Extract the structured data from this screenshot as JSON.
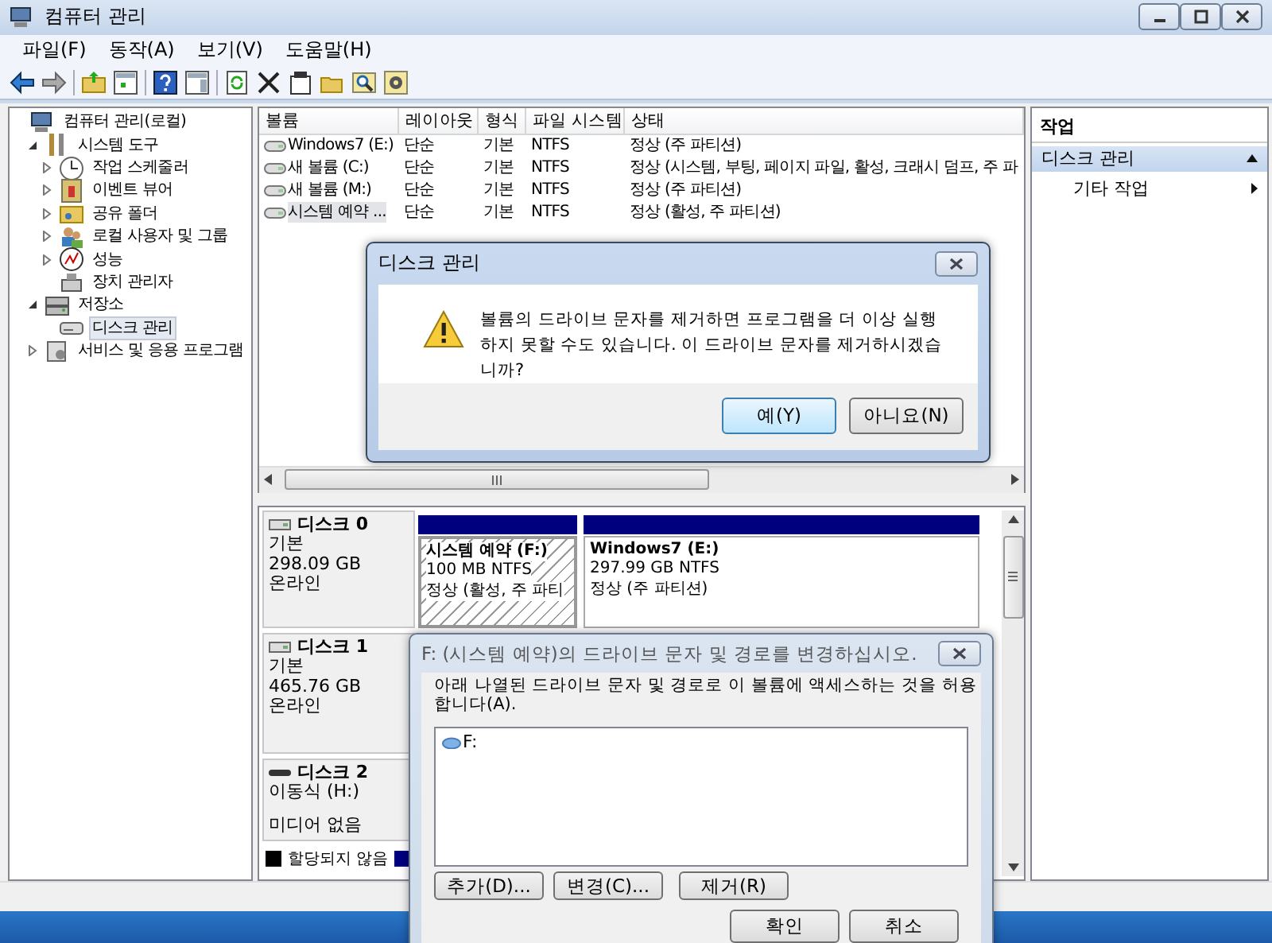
{
  "window": {
    "title": "컴퓨터 관리"
  },
  "menu": [
    "파일(F)",
    "동작(A)",
    "보기(V)",
    "도움말(H)"
  ],
  "tree": [
    {
      "label": "컴퓨터 관리(로컬)",
      "selected": false,
      "children": [
        {
          "label": "시스템 도구",
          "expanded": true,
          "selected": false,
          "children": [
            {
              "label": "작업 스케줄러",
              "expanded": false,
              "selected": false
            },
            {
              "label": "이벤트 뷰어",
              "expanded": false,
              "selected": false
            },
            {
              "label": "공유 폴더",
              "expanded": false,
              "selected": false
            },
            {
              "label": "로컬 사용자 및 그룹",
              "expanded": false,
              "selected": false
            },
            {
              "label": "성능",
              "expanded": false,
              "selected": false
            },
            {
              "label": "장치 관리자",
              "selected": false
            }
          ]
        },
        {
          "label": "저장소",
          "expanded": true,
          "selected": false,
          "children": [
            {
              "label": "디스크 관리",
              "selected": true
            }
          ]
        },
        {
          "label": "서비스 및 응용 프로그램",
          "expanded": false,
          "selected": false
        }
      ]
    }
  ],
  "volume_table": {
    "columns": [
      "볼륨",
      "레이아웃",
      "형식",
      "파일 시스템",
      "상태"
    ],
    "rows": [
      {
        "cells": [
          "Windows7 (E:)",
          "단순",
          "기본",
          "NTFS",
          "정상 (주 파티션)"
        ],
        "selected": false
      },
      {
        "cells": [
          "새 볼륨 (C:)",
          "단순",
          "기본",
          "NTFS",
          "정상 (시스템, 부팅, 페이지 파일, 활성, 크래시 덤프, 주 파"
        ],
        "selected": false
      },
      {
        "cells": [
          "새 볼륨 (M:)",
          "단순",
          "기본",
          "NTFS",
          "정상 (주 파티션)"
        ],
        "selected": false
      },
      {
        "cells": [
          "시스템 예약 ...",
          "단순",
          "기본",
          "NTFS",
          "정상 (활성, 주 파티션)"
        ],
        "selected": true
      }
    ]
  },
  "disks": [
    {
      "kind": "fixed",
      "name": "디스크 0",
      "type": "기본",
      "size": "298.09 GB",
      "status": "온라인",
      "partitions": [
        {
          "name": "시스템 예약  (F:)",
          "size": "100 MB NTFS",
          "status": "정상 (활성, 주 파티",
          "selected": true
        },
        {
          "name": "Windows7  (E:)",
          "size": "297.99 GB NTFS",
          "status": "정상 (주 파티션)",
          "selected": false
        }
      ]
    },
    {
      "kind": "fixed",
      "name": "디스크 1",
      "type": "기본",
      "size": "465.76 GB",
      "status": "온라인"
    },
    {
      "kind": "removable",
      "name": "디스크 2",
      "type": "이동식 (H:)",
      "status": "미디어 없음"
    }
  ],
  "legend": [
    {
      "label": "할당되지 않음",
      "color": "#000000"
    },
    {
      "color": "#00007f"
    }
  ],
  "actions": {
    "title": "작업",
    "sections": [
      {
        "label": "디스크 관리",
        "expanded": true,
        "items": [
          "기타 작업"
        ]
      }
    ]
  },
  "confirm_dialog": {
    "title": "디스크 관리",
    "message": "볼륨의 드라이브 문자를 제거하면 프로그램을 더 이상 실행하지 못할 수도 있습니다. 이 드라이브 문자를 제거하시겠습니까?",
    "buttons": [
      {
        "label": "예(Y)",
        "default": true
      },
      {
        "label": "아니요(N)",
        "default": false
      }
    ]
  },
  "path_dialog": {
    "title": "F: (시스템 예약)의 드라이브 문자 및 경로를 변경하십시오.",
    "label": "아래 나열된 드라이브 문자 및 경로로 이 볼륨에 액세스하는 것을 허용합니다(A).",
    "paths": [
      {
        "label": "F:",
        "selected": false
      }
    ],
    "actions": [
      "추가(D)...",
      "변경(C)...",
      "제거(R)"
    ],
    "buttons": [
      "확인",
      "취소"
    ]
  }
}
